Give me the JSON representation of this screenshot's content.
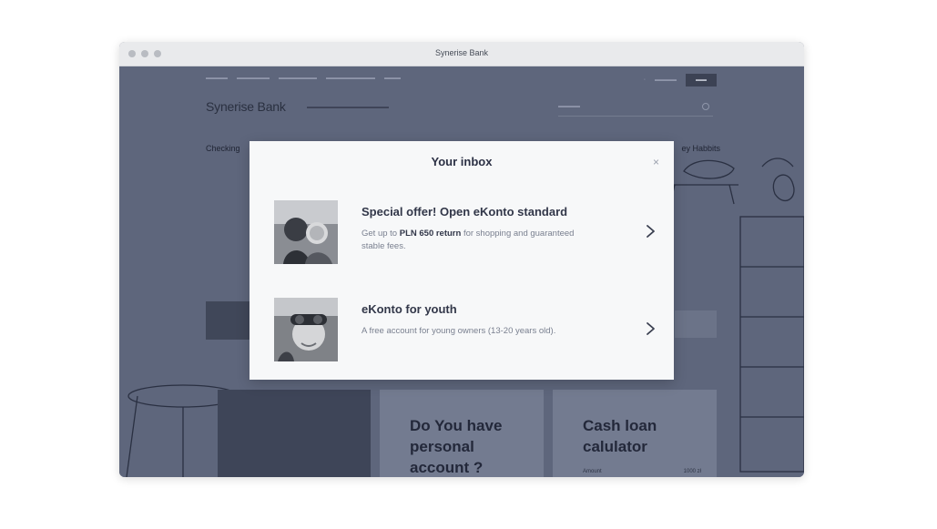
{
  "window": {
    "title": "Synerise Bank"
  },
  "page": {
    "brand": "Synerise Bank",
    "nav_left": "Checking",
    "nav_right": "ey Habbits",
    "cards": [
      {
        "title": "Do You have personal account ?"
      },
      {
        "title": "Cash loan calulator",
        "row_left": "Amount",
        "row_right": "1000 zł"
      }
    ]
  },
  "modal": {
    "title": "Your inbox",
    "close_icon": "×",
    "items": [
      {
        "title": "Special offer! Open eKonto standard",
        "desc_prefix": "Get up to ",
        "desc_bold": "PLN 650 return",
        "desc_suffix": " for shopping and guaranteed stable fees."
      },
      {
        "title": "eKonto for youth",
        "desc": "A free account for young owners (13-20 years old)."
      }
    ]
  },
  "colors": {
    "overlay": "#5e667c",
    "modal_bg": "#f7f8f9",
    "text_dark": "#323749",
    "text_muted": "#7a8090"
  }
}
